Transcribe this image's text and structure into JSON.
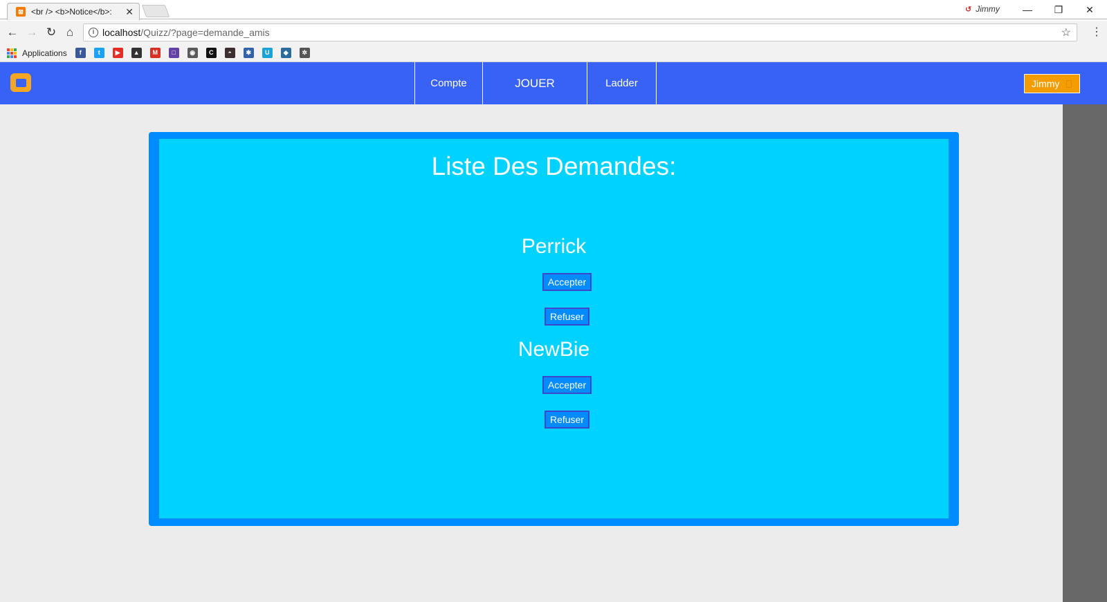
{
  "browser": {
    "tab": {
      "title": "<br /> <b>Notice</b>:",
      "close_glyph": "✕"
    },
    "profile": {
      "name": "Jimmy"
    },
    "window_controls": {
      "minimize": "—",
      "restore": "❐",
      "close": "✕"
    },
    "nav": {
      "back": "←",
      "forward": "→",
      "reload": "↻",
      "home": "⌂"
    },
    "address": {
      "host": "localhost",
      "path": "/Quizz/?page=demande_amis"
    },
    "bookmarks": {
      "apps_label": "Applications",
      "items": [
        {
          "icon": "facebook-icon",
          "glyph": "f",
          "color": "#3b5998"
        },
        {
          "icon": "twitter-icon",
          "glyph": "t",
          "color": "#1da1f2"
        },
        {
          "icon": "youtube-icon",
          "glyph": "▶",
          "color": "#e52d27"
        },
        {
          "icon": "gallery-icon",
          "glyph": "▲",
          "color": "#333333"
        },
        {
          "icon": "gmail-icon",
          "glyph": "M",
          "color": "#d93025"
        },
        {
          "icon": "twitch-icon",
          "glyph": "□",
          "color": "#6441a5"
        },
        {
          "icon": "coin-icon",
          "glyph": "◉",
          "color": "#5a5a5a"
        },
        {
          "icon": "c-site-icon",
          "glyph": "C",
          "color": "#111111"
        },
        {
          "icon": "hat-icon",
          "glyph": "◓",
          "color": "#3b2f2f"
        },
        {
          "icon": "figure-icon",
          "glyph": "✱",
          "color": "#3462a8"
        },
        {
          "icon": "u-site-icon",
          "glyph": "U",
          "color": "#1aa3d9"
        },
        {
          "icon": "cloud-icon",
          "glyph": "◆",
          "color": "#2c6c9c"
        },
        {
          "icon": "gear-icon",
          "glyph": "✲",
          "color": "#555555"
        }
      ]
    }
  },
  "site": {
    "nav": {
      "compte": "Compte",
      "jouer": "JOUER",
      "ladder": "Ladder"
    },
    "user_button": "Jimmy",
    "colors": {
      "navbar": "#3861f5",
      "panel_border": "#008cff",
      "panel_bg": "#00d2ff",
      "user_button": "#f59d00"
    }
  },
  "main": {
    "title": "Liste Des Demandes:",
    "requests": [
      {
        "name": "Perrick",
        "accept_label": "Accepter",
        "refuse_label": "Refuser"
      },
      {
        "name": "NewBie",
        "accept_label": "Accepter",
        "refuse_label": "Refuser"
      }
    ]
  }
}
